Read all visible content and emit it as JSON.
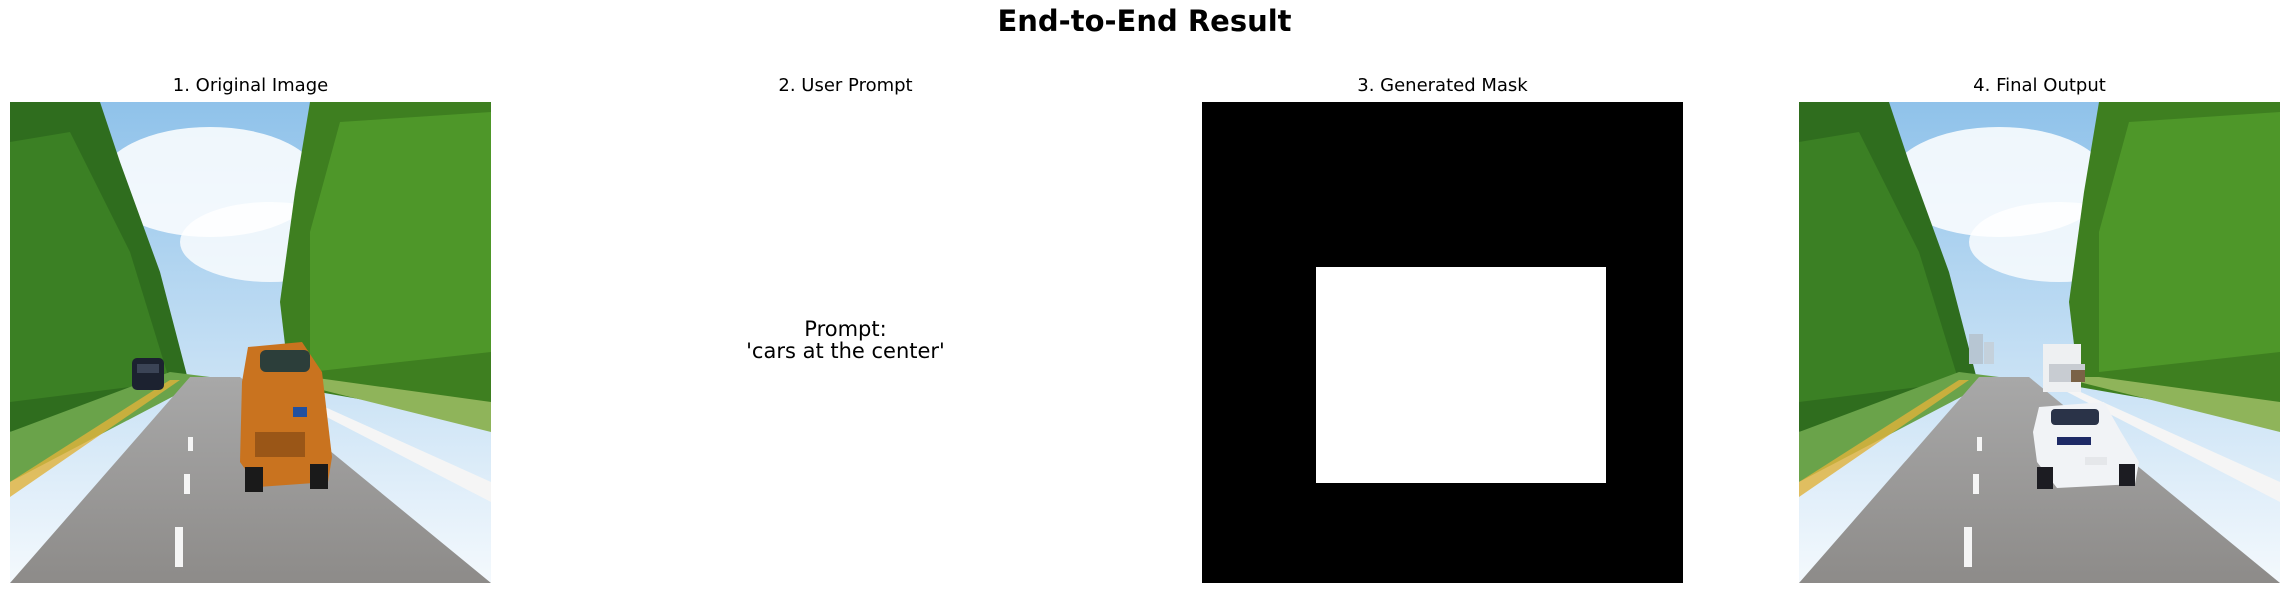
{
  "figure": {
    "title": "End-to-End Result"
  },
  "panels": [
    {
      "title": "1. Original Image"
    },
    {
      "title": "2. User Prompt",
      "prompt_label": "Prompt:",
      "prompt_value": "'cars at the center'"
    },
    {
      "title": "3. Generated Mask"
    },
    {
      "title": "4. Final Output"
    }
  ],
  "colors": {
    "sky": "#d9ebf7",
    "trees": "#3f7a1f",
    "road": "#8a8a8a",
    "mask_bg": "#000000",
    "mask_fg": "#ffffff",
    "orange_car": "#c9731f",
    "white_car": "#f1f3f6"
  }
}
